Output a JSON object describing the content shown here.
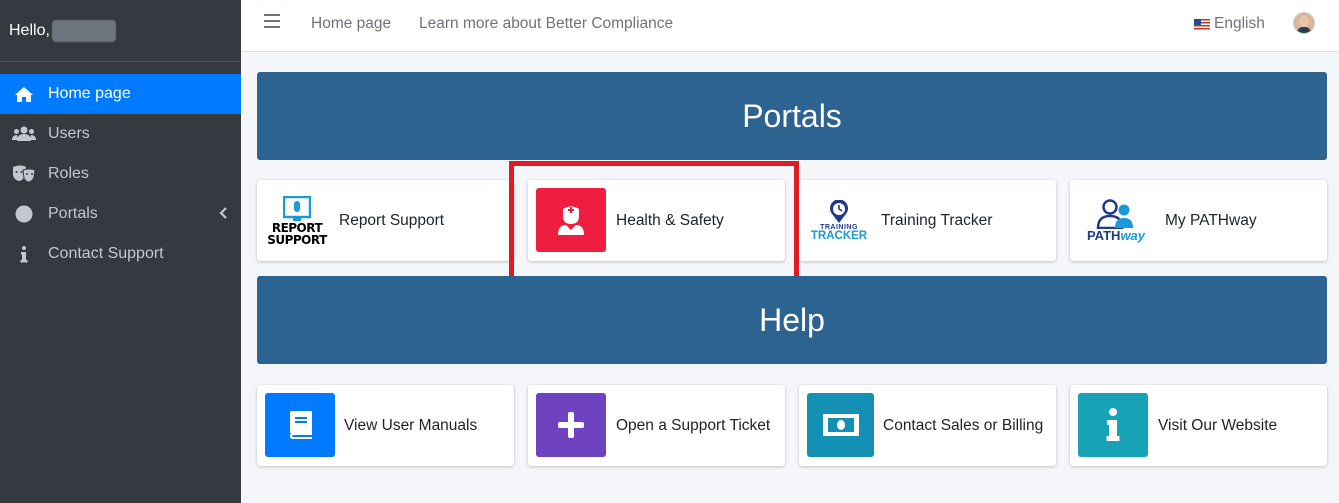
{
  "sidebar": {
    "greeting": "Hello,",
    "items": [
      {
        "label": "Home page",
        "icon": "home-icon",
        "active": true
      },
      {
        "label": "Users",
        "icon": "users-icon"
      },
      {
        "label": "Roles",
        "icon": "masks-icon"
      },
      {
        "label": "Portals",
        "icon": "circle-icon"
      },
      {
        "label": "Contact Support",
        "icon": "info-icon"
      }
    ]
  },
  "topbar": {
    "links": [
      "Home page",
      "Learn more about Better Compliance"
    ],
    "language": "English"
  },
  "portals": {
    "title": "Portals",
    "cards": [
      {
        "label": "Report Support",
        "logo_line1": "REPORT",
        "logo_line2": "SUPPORT"
      },
      {
        "label": "Health & Safety",
        "color": "#ef1d3f"
      },
      {
        "label": "Training Tracker",
        "logo_line1": "TRAINING",
        "logo_line2": "TRACKER"
      },
      {
        "label": "My PATHway",
        "logo_path": "PATH",
        "logo_way": "way"
      }
    ]
  },
  "help": {
    "title": "Help",
    "cards": [
      {
        "label": "View User Manuals",
        "color": "#007bff"
      },
      {
        "label": "Open a Support Ticket",
        "color": "#6f42c1"
      },
      {
        "label": "Contact Sales or Billing",
        "color": "#1590b5"
      },
      {
        "label": "Visit Our Website",
        "color": "#17a2b8"
      }
    ]
  },
  "colors": {
    "sidebar": "#343a40",
    "active": "#007bff",
    "banner": "#2c6390",
    "highlight": "#e01b24"
  }
}
